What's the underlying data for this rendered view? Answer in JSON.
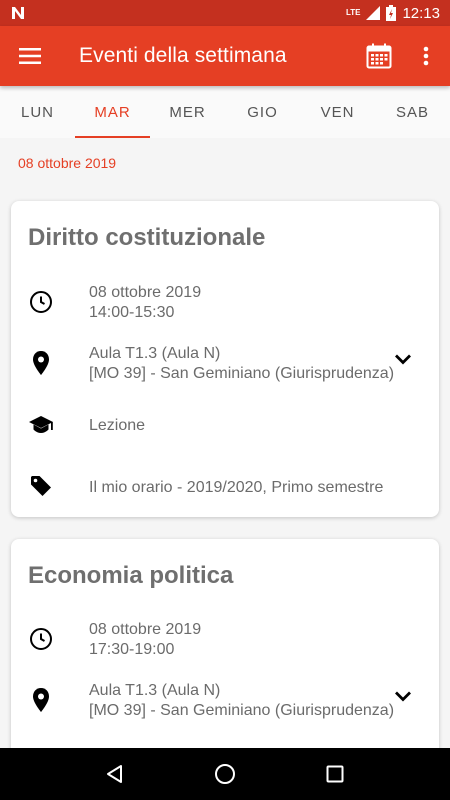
{
  "status_bar": {
    "network_label": "LTE",
    "time": "12:13"
  },
  "app_bar": {
    "title": "Eventi della settimana",
    "menu_icon": "menu-icon",
    "calendar_icon": "calendar-icon",
    "more_icon": "more-vert-icon"
  },
  "tabs": [
    {
      "label": "LUN",
      "active": false
    },
    {
      "label": "MAR",
      "active": true
    },
    {
      "label": "MER",
      "active": false
    },
    {
      "label": "GIO",
      "active": false
    },
    {
      "label": "VEN",
      "active": false
    },
    {
      "label": "SAB",
      "active": false
    }
  ],
  "date_header": "08 ottobre 2019",
  "events": [
    {
      "title": "Diritto costituzionale",
      "date": "08 ottobre 2019",
      "time": "14:00-15:30",
      "room": "Aula T1.3 (Aula N)",
      "building": "[MO 39] - San Geminiano (Giurisprudenza)",
      "type": "Lezione",
      "calendar": "Il mio orario - 2019/2020, Primo semestre"
    },
    {
      "title": "Economia politica",
      "date": "08 ottobre 2019",
      "time": "17:30-19:00",
      "room": "Aula T1.3 (Aula N)",
      "building": "[MO 39] - San Geminiano (Giurisprudenza)"
    }
  ],
  "colors": {
    "status_bar": "#c4301f",
    "app_bar": "#e53f24",
    "accent": "#e53f24"
  }
}
